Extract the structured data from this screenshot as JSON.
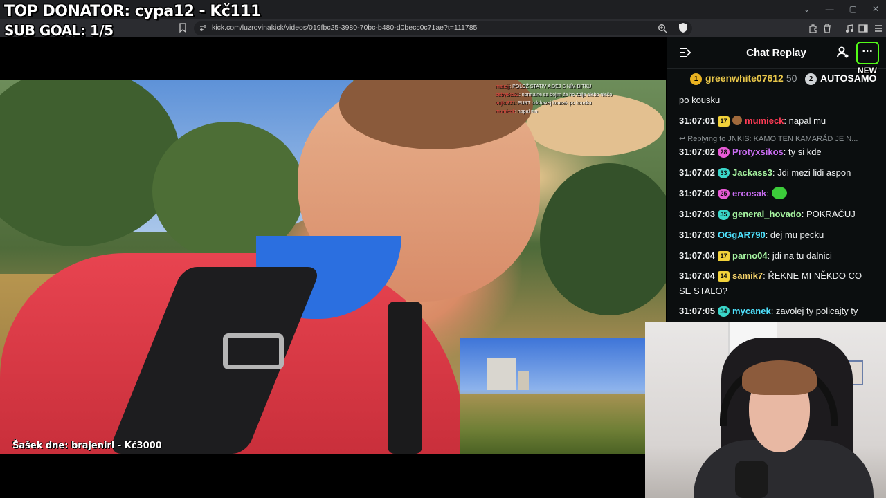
{
  "browser": {
    "url": "kick.com/luzrovinakick/videos/019fbc25-3980-70bc-b480-d0becc0c71ae?t=111785"
  },
  "overlay": {
    "top_donator": "TOP DONATOR: cypa12 - Kč111",
    "sub_goal": "SUB GOAL: 1/5",
    "caption": "Šašek dne: brajenirl - Kč3000"
  },
  "video_chat_overlay": [
    {
      "user": "matejjj",
      "text": ": POLOŽ STATIV A DEJ S NÍM BITKU"
    },
    {
      "user": "sebyeko22",
      "text": ": normalne sa bojim že ho zbije alebo niečo"
    },
    {
      "user": "vojko321",
      "text": ": FURT odchazej kousek po kousku"
    },
    {
      "user": "mumieck",
      "text": ": napal mu"
    }
  ],
  "chat": {
    "title": "Chat Replay",
    "more_label": "···",
    "new_label": "NEW",
    "pinned": [
      {
        "rank": "1",
        "name": "greenwhite07612",
        "score": "50"
      },
      {
        "rank": "2",
        "name": "AUTOSAMO",
        "score": ""
      }
    ],
    "partial_message": "po kousku",
    "reply_context": "Replying to JNKIS: KAMO TEN KAMARÁD JE N...",
    "messages": [
      {
        "time": "31:07:01",
        "badge": "17",
        "badge_color": "#f2d23a",
        "user": "mumieck",
        "user_color": "#ff3b55",
        "text": ": napal mu"
      },
      {
        "time": "31:07:02",
        "badge": "28",
        "badge_color": "#e85ad6",
        "user": "Protyxsikos",
        "user_color": "#c86cf0",
        "text": ": ty si kde"
      },
      {
        "time": "31:07:02",
        "badge": "33",
        "badge_color": "#3ad6c9",
        "user": "Jackass3",
        "user_color": "#a6f3a0",
        "text": ": Jdi mezi lidi aspon"
      },
      {
        "time": "31:07:02",
        "badge": "25",
        "badge_color": "#e85ad6",
        "user": "ercosak",
        "user_color": "#c86cf0",
        "text": ":"
      },
      {
        "time": "31:07:03",
        "badge": "35",
        "badge_color": "#3ad6c9",
        "user": "general_hovado",
        "user_color": "#a6f3a0",
        "text": ": POKRAČUJ"
      },
      {
        "time": "31:07:03",
        "badge": "",
        "badge_color": "",
        "user": "OGgAR790",
        "user_color": "#4fe3ff",
        "text": ": dej mu pecku"
      },
      {
        "time": "31:07:04",
        "badge": "17",
        "badge_color": "#f2d23a",
        "user": "parno04",
        "user_color": "#a6f3a0",
        "text": ": jdi na tu dalnici"
      },
      {
        "time": "31:07:04",
        "badge": "14",
        "badge_color": "#f2d23a",
        "user": "samik7",
        "user_color": "#f5d26a",
        "text": ": ŘEKNE MI NĚKDO CO SE STALO?"
      },
      {
        "time": "31:07:05",
        "badge": "34",
        "badge_color": "#3ad6c9",
        "user": "mycanek",
        "user_color": "#4fe3ff",
        "text": ": zavolej ty policajty ty"
      }
    ]
  },
  "colors": {
    "accent": "#53fc18",
    "chat_bg": "#0b0e0f"
  }
}
